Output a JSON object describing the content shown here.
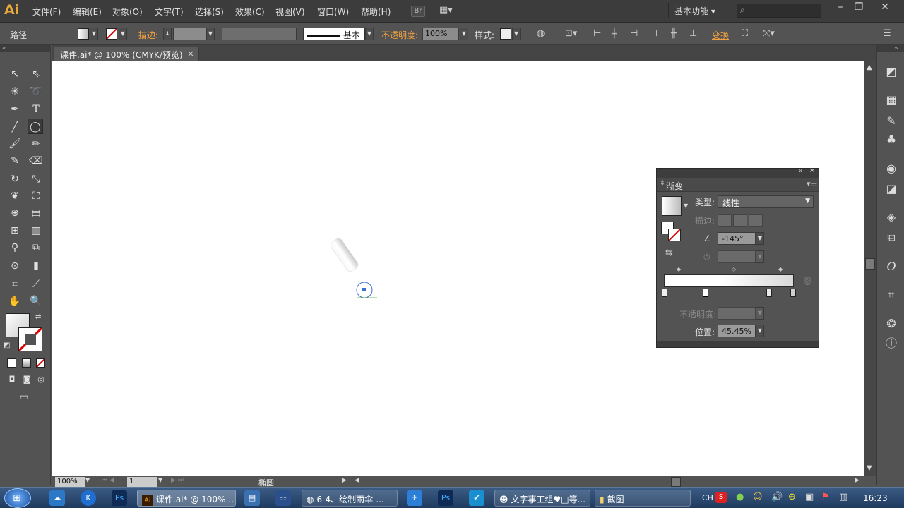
{
  "app": {
    "logo": "Ai",
    "bridge": "Br"
  },
  "menu": [
    "文件(F)",
    "编辑(E)",
    "对象(O)",
    "文字(T)",
    "选择(S)",
    "效果(C)",
    "视图(V)",
    "窗口(W)",
    "帮助(H)"
  ],
  "workspace": {
    "label": "基本功能 ▾"
  },
  "window_controls": [
    "–",
    "❐",
    "✕"
  ],
  "control_bar": {
    "object_type": "路径",
    "stroke_label": "描边:",
    "stroke_style": "基本",
    "opacity_label": "不透明度:",
    "opacity_value": "100%",
    "style_label": "样式:",
    "transform_label": "变换"
  },
  "document": {
    "tab_title": "课件.ai* @ 100% (CMYK/预览)",
    "tab_close": "×"
  },
  "status_bar": {
    "zoom": "100%",
    "page": "1",
    "tool_name": "椭圆"
  },
  "gradient_panel": {
    "title": "渐变",
    "type_label": "类型:",
    "type_value": "线性",
    "stroke_label": "描边:",
    "angle_value": "-145°",
    "opacity_label": "不透明度:",
    "position_label": "位置:",
    "position_value": "45.45%"
  },
  "taskbar": {
    "tasks": [
      "课件.ai* @ 100%...",
      "6-4、绘制雨伞-...",
      "文字事工组♥□等...",
      "截图"
    ],
    "lang": "CH",
    "clock": "16:23"
  },
  "colors": {
    "accent": "#e8a93a",
    "orange_label": "#f0a040",
    "taskbar": "#1f3a5e"
  }
}
